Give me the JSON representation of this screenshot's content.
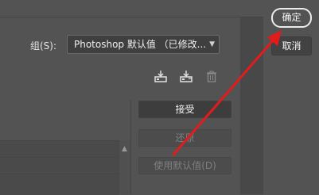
{
  "group": {
    "label": "组(S):",
    "selected_value": "Photoshop 默认值 （已修改..."
  },
  "icons": [
    "save-set-icon",
    "load-set-icon",
    "trash-icon"
  ],
  "buttons": {
    "accept": "接受",
    "restore": "还原",
    "use_default": "使用默认值(D)",
    "ok": "确定",
    "cancel": "取消"
  },
  "colors": {
    "background": "#535353",
    "annotation_arrow": "#e21c1c"
  }
}
